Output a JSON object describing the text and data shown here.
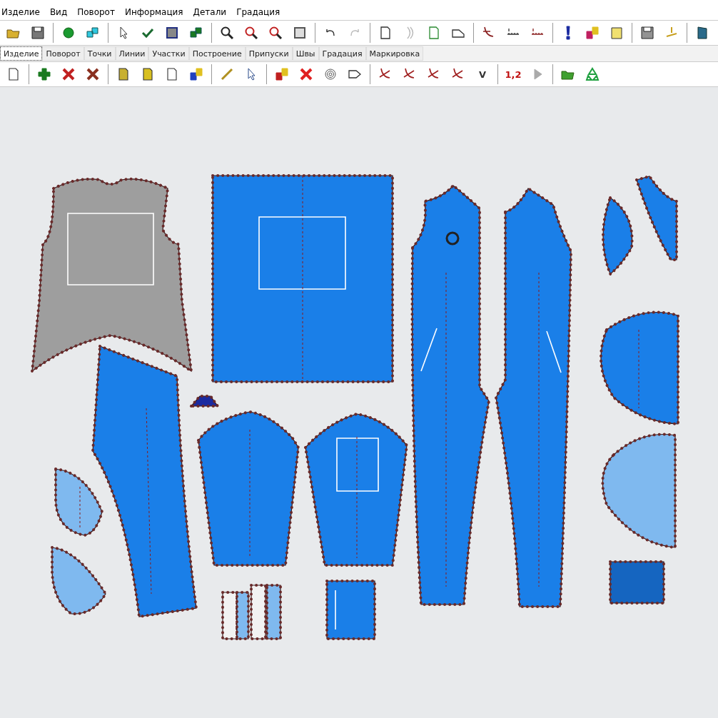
{
  "menu": [
    {
      "label": "Изделие"
    },
    {
      "label": "Вид"
    },
    {
      "label": "Поворот"
    },
    {
      "label": "Информация"
    },
    {
      "label": "Детали"
    },
    {
      "label": "Градация"
    }
  ],
  "tabs": [
    {
      "label": "Изделие",
      "selected": true
    },
    {
      "label": "Поворот",
      "selected": false
    },
    {
      "label": "Точки",
      "selected": false
    },
    {
      "label": "Линии",
      "selected": false
    },
    {
      "label": "Участки",
      "selected": false
    },
    {
      "label": "Построение",
      "selected": false
    },
    {
      "label": "Припуски",
      "selected": false
    },
    {
      "label": "Швы",
      "selected": false
    },
    {
      "label": "Градация",
      "selected": false
    },
    {
      "label": "Маркировка",
      "selected": false
    }
  ],
  "toolbar_2": {
    "labels": [
      "V",
      "1,2"
    ]
  }
}
